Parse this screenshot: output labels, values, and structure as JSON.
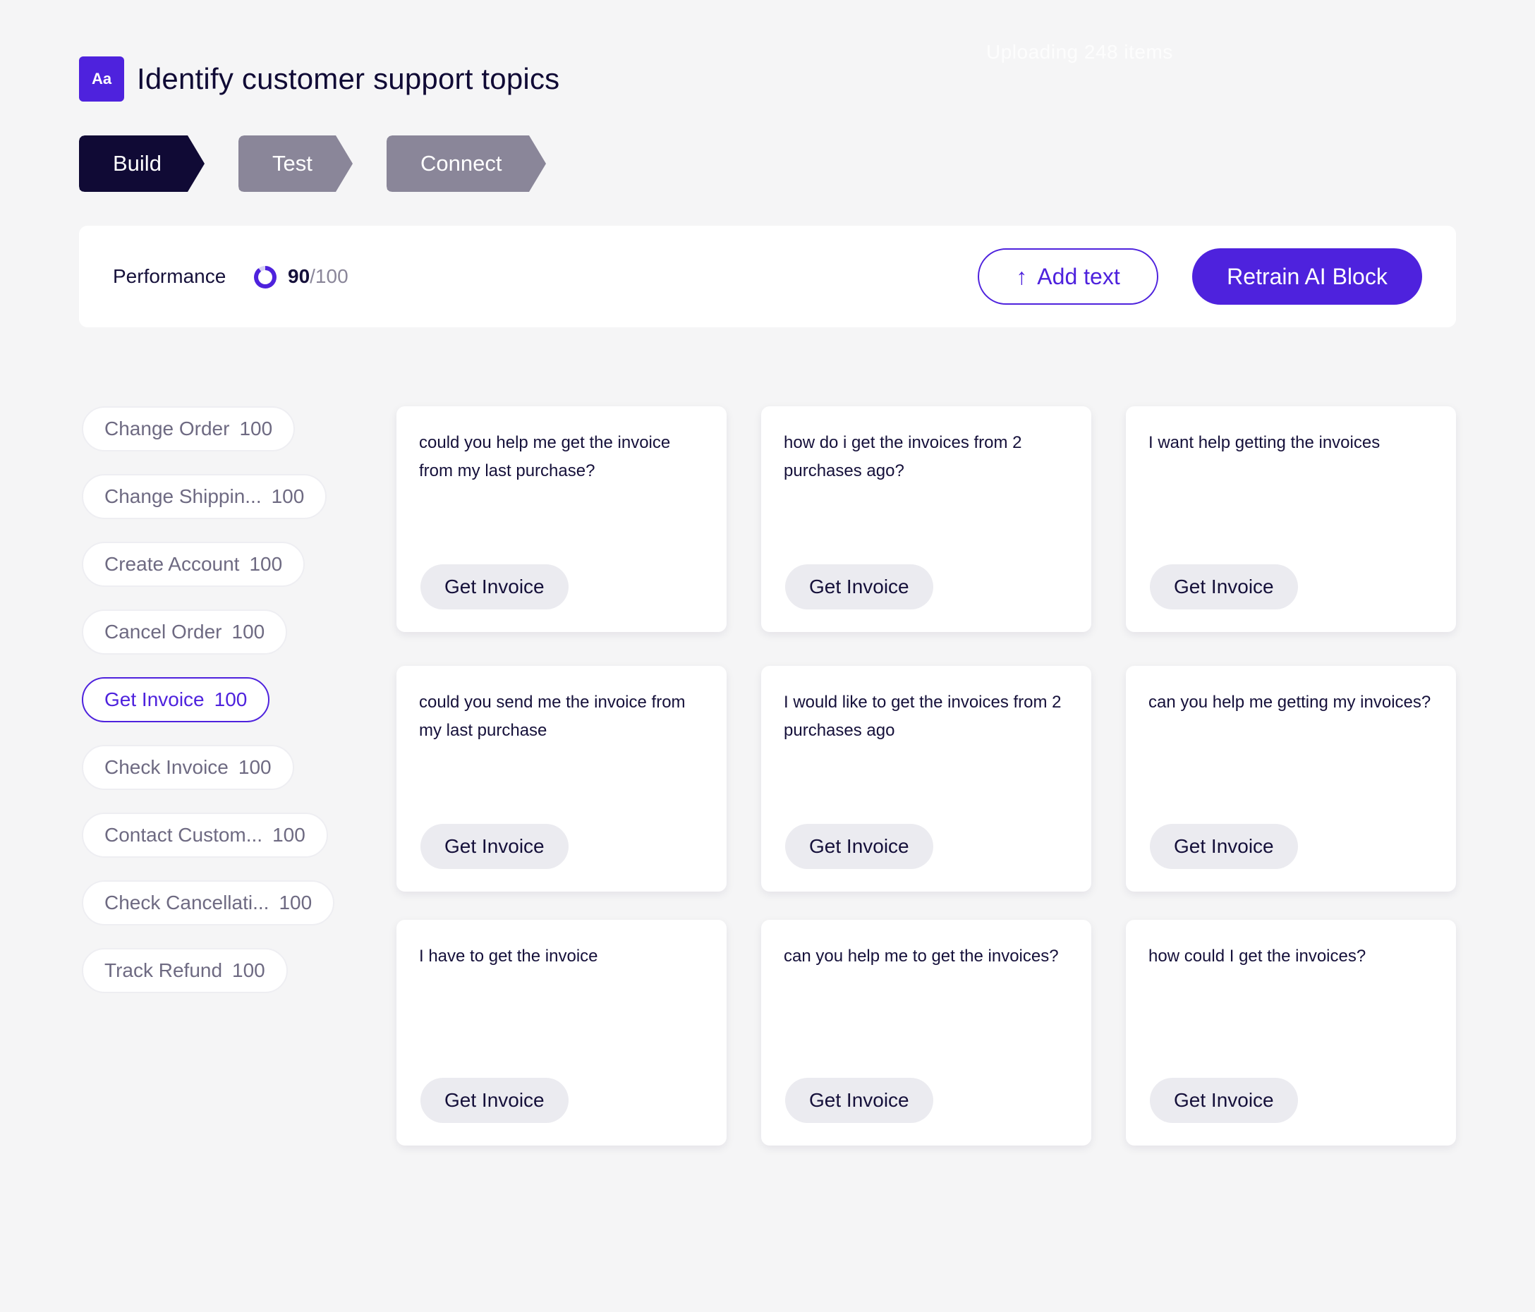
{
  "upload_notice": "Uploading 248 items",
  "header": {
    "icon_label": "Aa",
    "title": "Identify customer support topics"
  },
  "steps": [
    {
      "label": "Build",
      "state": "active"
    },
    {
      "label": "Test",
      "state": "inactive"
    },
    {
      "label": "Connect",
      "state": "inactive"
    }
  ],
  "performance": {
    "label": "Performance",
    "score": "90",
    "max": "/100",
    "score_fraction": 0.9
  },
  "actions": {
    "add_text_icon": "arrow-up-icon",
    "add_text_label": "Add text",
    "retrain_label": "Retrain AI Block"
  },
  "topics": [
    {
      "label": "Change Order",
      "count": "100",
      "active": false
    },
    {
      "label": "Change Shippin...",
      "count": "100",
      "active": false
    },
    {
      "label": "Create Account",
      "count": "100",
      "active": false
    },
    {
      "label": "Cancel Order",
      "count": "100",
      "active": false
    },
    {
      "label": "Get Invoice",
      "count": "100",
      "active": true
    },
    {
      "label": "Check Invoice",
      "count": "100",
      "active": false
    },
    {
      "label": "Contact Custom...",
      "count": "100",
      "active": false
    },
    {
      "label": "Check Cancellati...",
      "count": "100",
      "active": false
    },
    {
      "label": "Track Refund",
      "count": "100",
      "active": false
    }
  ],
  "cards": [
    {
      "text": "could you help me get the invoice from my last purchase?",
      "tag": "Get Invoice"
    },
    {
      "text": "how do i get the invoices from 2 purchases ago?",
      "tag": "Get Invoice"
    },
    {
      "text": "I want help getting the invoices",
      "tag": "Get Invoice"
    },
    {
      "text": "could you send me the invoice from my last purchase",
      "tag": "Get Invoice"
    },
    {
      "text": "I would like to get the invoices from 2 purchases ago",
      "tag": "Get Invoice"
    },
    {
      "text": "can you help me getting my invoices?",
      "tag": "Get Invoice"
    },
    {
      "text": "I have to get the invoice",
      "tag": "Get Invoice"
    },
    {
      "text": "can you help me to get the invoices?",
      "tag": "Get Invoice"
    },
    {
      "text": "how could I get the invoices?",
      "tag": "Get Invoice"
    }
  ],
  "colors": {
    "accent": "#4e22dd",
    "dark": "#100a35",
    "inactive_step": "#8a8699",
    "background": "#f5f5f6"
  }
}
